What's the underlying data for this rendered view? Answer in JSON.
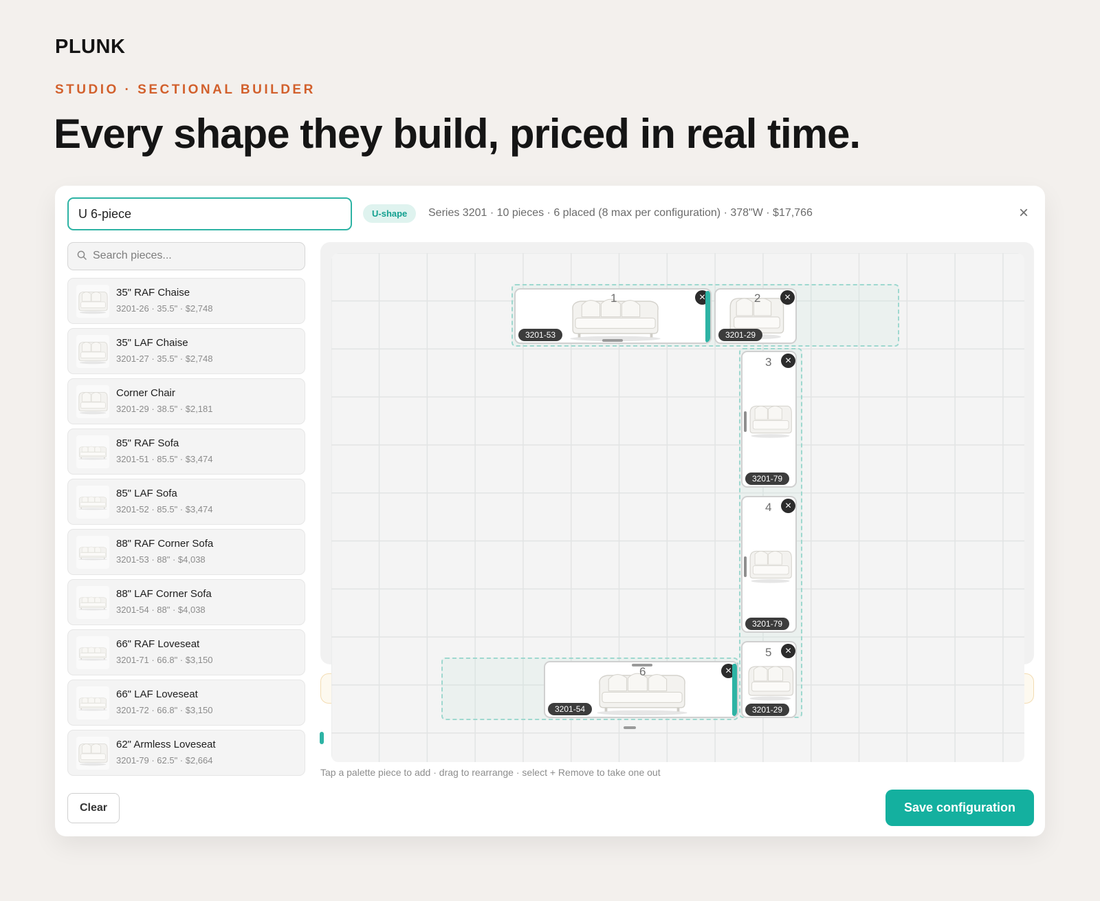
{
  "brand": {
    "logo": "PLUNK"
  },
  "hero": {
    "eyebrow": "STUDIO · SECTIONAL BUILDER",
    "headline": "Every shape they build, priced in real time."
  },
  "builder": {
    "config_name_value": "U 6-piece",
    "shape_badge": "U-shape",
    "summary": "Series 3201 · 10 pieces · 6 placed (8 max per configuration) · 378\"W · $17,766",
    "close_icon": "×",
    "search_placeholder": "Search pieces...",
    "palette": [
      {
        "name": "35\" RAF Chaise",
        "meta": "3201-26 · 35.5\" · $2,748"
      },
      {
        "name": "35\" LAF Chaise",
        "meta": "3201-27 · 35.5\" · $2,748"
      },
      {
        "name": "Corner Chair",
        "meta": "3201-29 · 38.5\" · $2,181"
      },
      {
        "name": "85\" RAF Sofa",
        "meta": "3201-51 · 85.5\" · $3,474"
      },
      {
        "name": "85\" LAF Sofa",
        "meta": "3201-52 · 85.5\" · $3,474"
      },
      {
        "name": "88\" RAF Corner Sofa",
        "meta": "3201-53 · 88\" · $4,038"
      },
      {
        "name": "88\" LAF Corner Sofa",
        "meta": "3201-54 · 88\" · $4,038"
      },
      {
        "name": "66\" RAF Loveseat",
        "meta": "3201-71 · 66.8\" · $3,150"
      },
      {
        "name": "66\" LAF Loveseat",
        "meta": "3201-72 · 66.8\" · $3,150"
      },
      {
        "name": "62\" Armless Loveseat",
        "meta": "3201-79 · 62.5\" · $2,664"
      }
    ],
    "placed": [
      {
        "number": "1",
        "sku": "3201-53"
      },
      {
        "number": "2",
        "sku": "3201-29"
      },
      {
        "number": "3",
        "sku": "3201-79"
      },
      {
        "number": "4",
        "sku": "3201-79"
      },
      {
        "number": "5",
        "sku": "3201-29"
      },
      {
        "number": "6",
        "sku": "3201-54"
      }
    ],
    "remove_icon": "×",
    "hint": "Tap a palette piece to add · drag to rearrange · select + Remove to take one out",
    "clear_label": "Clear",
    "save_label": "Save configuration"
  },
  "colors": {
    "accent": "#14b09f",
    "eyebrow": "#d2602c",
    "badge_bg": "#dff3ef"
  }
}
